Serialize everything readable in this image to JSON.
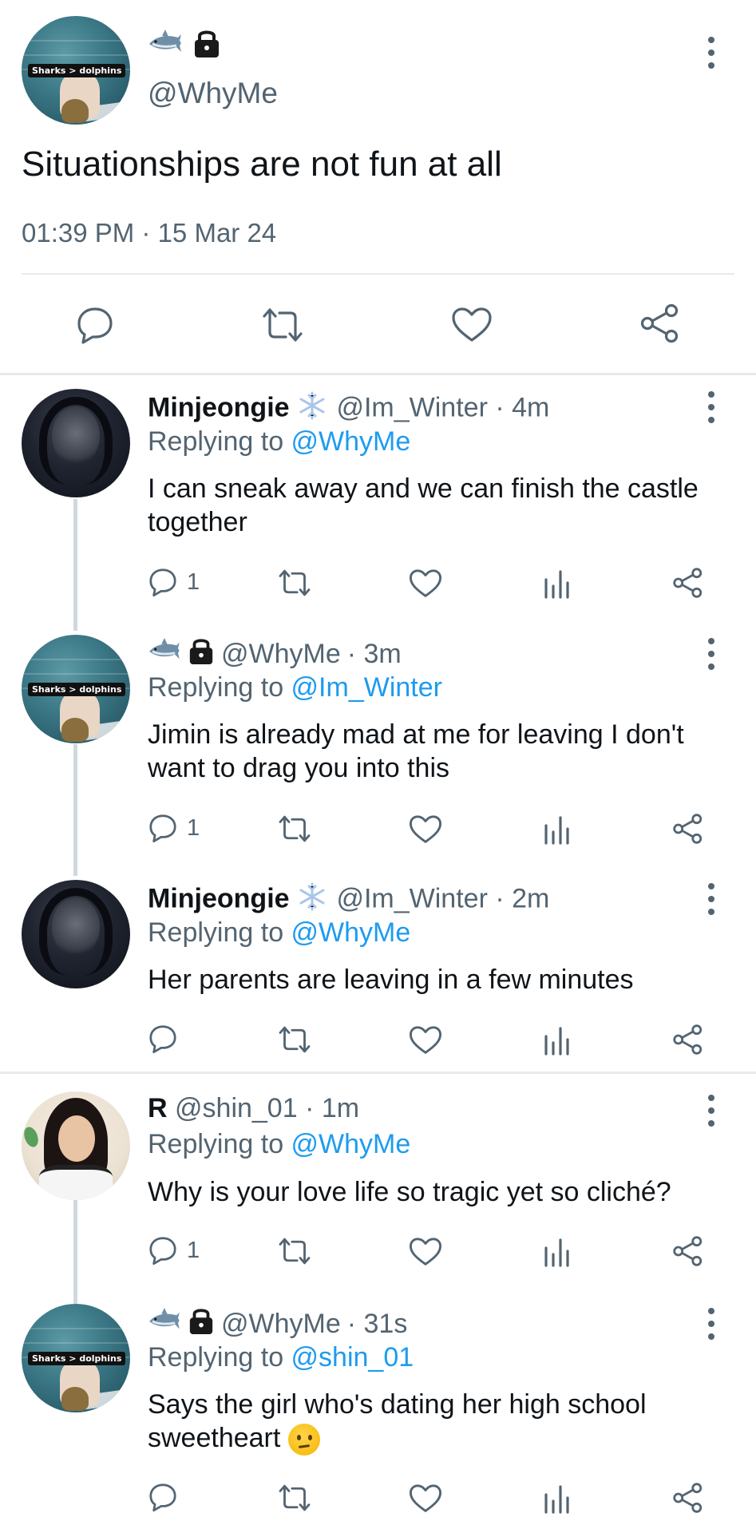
{
  "main_tweet": {
    "avatar_caption": "Sharks > dolphins",
    "emojis": [
      "shark-emoji",
      "lock-emoji"
    ],
    "handle": "@WhyMe",
    "text": "Situationships are not fun at all",
    "timestamp": "01:39 PM · 15 Mar 24"
  },
  "replies": [
    {
      "name": "Minjeongie",
      "badge": "snowflake-emoji",
      "handle": "@Im_Winter",
      "time": "· 4m",
      "replying_prefix": "Replying to ",
      "replying_to": "@WhyMe",
      "text": "I can sneak away and we can finish the castle together",
      "reply_count": "1"
    },
    {
      "avatar_caption": "Sharks > dolphins",
      "handle": "@WhyMe",
      "time": "· 3m",
      "replying_prefix": "Replying to ",
      "replying_to": "@Im_Winter",
      "text": "Jimin is already mad at me for leaving I don't want to drag you into this",
      "reply_count": "1"
    },
    {
      "name": "Minjeongie",
      "badge": "snowflake-emoji",
      "handle": "@Im_Winter",
      "time": "· 2m",
      "replying_prefix": "Replying to ",
      "replying_to": "@WhyMe",
      "text": "Her parents are leaving in a few minutes",
      "reply_count": ""
    },
    {
      "name": "R",
      "handle": "@shin_01",
      "time": "· 1m",
      "replying_prefix": "Replying to ",
      "replying_to": "@WhyMe",
      "text": "Why is your love life so tragic yet so cliché?",
      "reply_count": "1"
    },
    {
      "avatar_caption": "Sharks > dolphins",
      "handle": "@WhyMe",
      "time": "· 31s",
      "replying_prefix": "Replying to ",
      "replying_to": "@shin_01",
      "text": "Says the girl who's dating her high school sweetheart",
      "reply_count": ""
    }
  ],
  "colors": {
    "text": "#0f1419",
    "muted": "#536471",
    "link": "#1d9bf0",
    "divider": "#e7eaed"
  }
}
